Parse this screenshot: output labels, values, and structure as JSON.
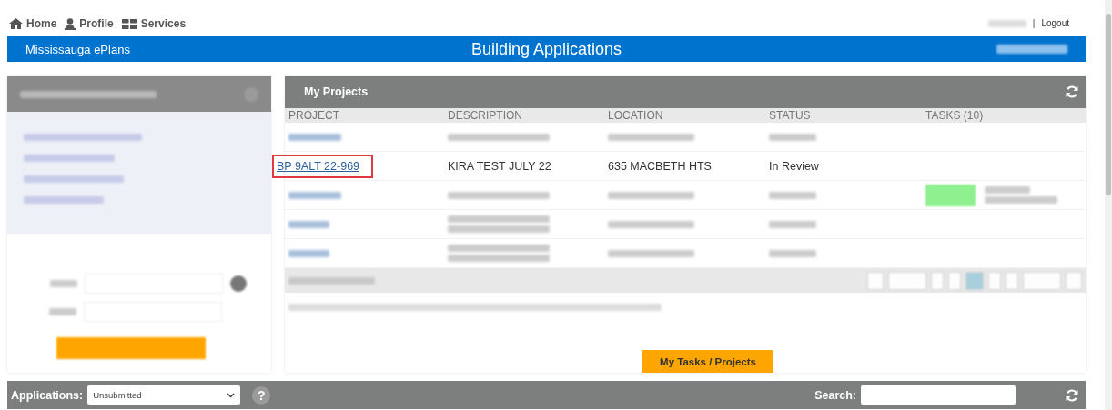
{
  "top_nav": {
    "items": [
      {
        "label": "Home"
      },
      {
        "label": "Profile"
      },
      {
        "label": "Services"
      }
    ],
    "separator": "|",
    "logout": "Logout"
  },
  "banner": {
    "site_name": "Mississauga ePlans",
    "title": "Building Applications"
  },
  "my_projects": {
    "title": "My Projects",
    "columns": [
      "PROJECT",
      "DESCRIPTION",
      "LOCATION",
      "STATUS",
      "TASKS (10)"
    ],
    "rows": [
      {
        "kind": "blurred",
        "task_action": false
      },
      {
        "kind": "text",
        "project": "BP 9ALT 22-969",
        "description": "KIRA TEST JULY 22",
        "location": "635 MACBETH HTS",
        "status": "In Review",
        "highlighted": true
      },
      {
        "kind": "tall",
        "task_action": true
      },
      {
        "kind": "tall",
        "task_action": false
      },
      {
        "kind": "tall",
        "task_action": false
      }
    ],
    "button": "My Tasks / Projects"
  },
  "bottom_bar": {
    "label": "Applications:",
    "select_value": "Unsubmitted",
    "help": "?",
    "search_label": "Search:"
  }
}
